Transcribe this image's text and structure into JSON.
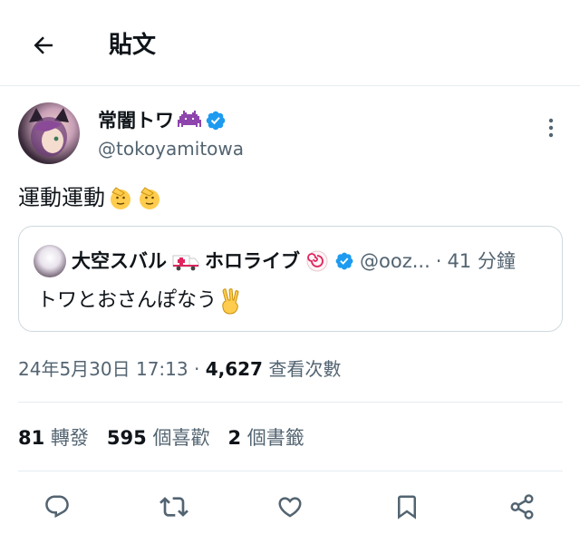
{
  "header": {
    "title": "貼文",
    "back_icon": "arrow-left-icon"
  },
  "author": {
    "name": "常闇トワ",
    "name_badge_icon": "purple-invader-icon",
    "verified_icon": "verified-check-icon",
    "handle": "@tokoyamitowa"
  },
  "tweet": {
    "text": "運動運動",
    "emoji": "saluting-face-icon"
  },
  "quote": {
    "name": "大空スバル",
    "name_emoji": "ambulance-icon",
    "name_suffix": "ホロライブ",
    "name_suffix_emoji": "fish-cake-icon",
    "handle": "@ooz...",
    "dot": "·",
    "time": "41 分鐘",
    "text": "トワとおさんぽなう",
    "text_emoji": "victory-hand-icon"
  },
  "meta": {
    "timestamp": "24年5月30日 17:13",
    "separator": "·",
    "views_count": "4,627",
    "views_label": "查看次數"
  },
  "stats": {
    "retweets_count": "81",
    "retweets_label": "轉發",
    "likes_count": "595",
    "likes_label": "個喜歡",
    "bookmarks_count": "2",
    "bookmarks_label": "個書籤"
  },
  "actions": [
    "reply-icon",
    "retweet-icon",
    "like-icon",
    "bookmark-icon",
    "share-icon"
  ],
  "colors": {
    "text_primary": "#0f1419",
    "text_secondary": "#536471",
    "verified_blue": "#1d9bf0",
    "border": "#cfd9de",
    "divider": "#e6ecf0"
  }
}
